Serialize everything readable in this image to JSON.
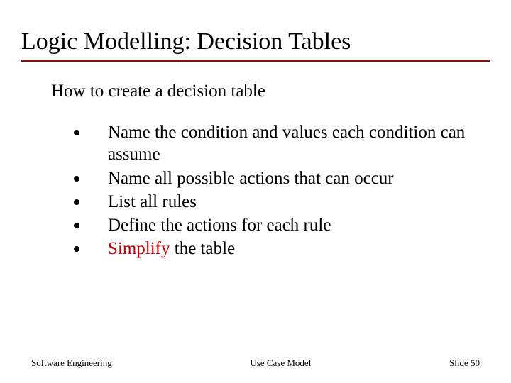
{
  "title": "Logic Modelling: Decision Tables",
  "subtitle": "How to  create a  decision table",
  "bullets": {
    "b0": "Name the condition and values each condition can assume",
    "b1": "Name all possible actions that can occur",
    "b2": "List all rules",
    "b3": "Define the actions for each rule",
    "b4_pre": "Simplify",
    "b4_post": " the table"
  },
  "footer": {
    "left": "Software Engineering",
    "center": "Use Case Model",
    "right": "Slide  50"
  },
  "colors": {
    "accent_rule": "#8a0f0f",
    "highlight": "#c00000"
  }
}
